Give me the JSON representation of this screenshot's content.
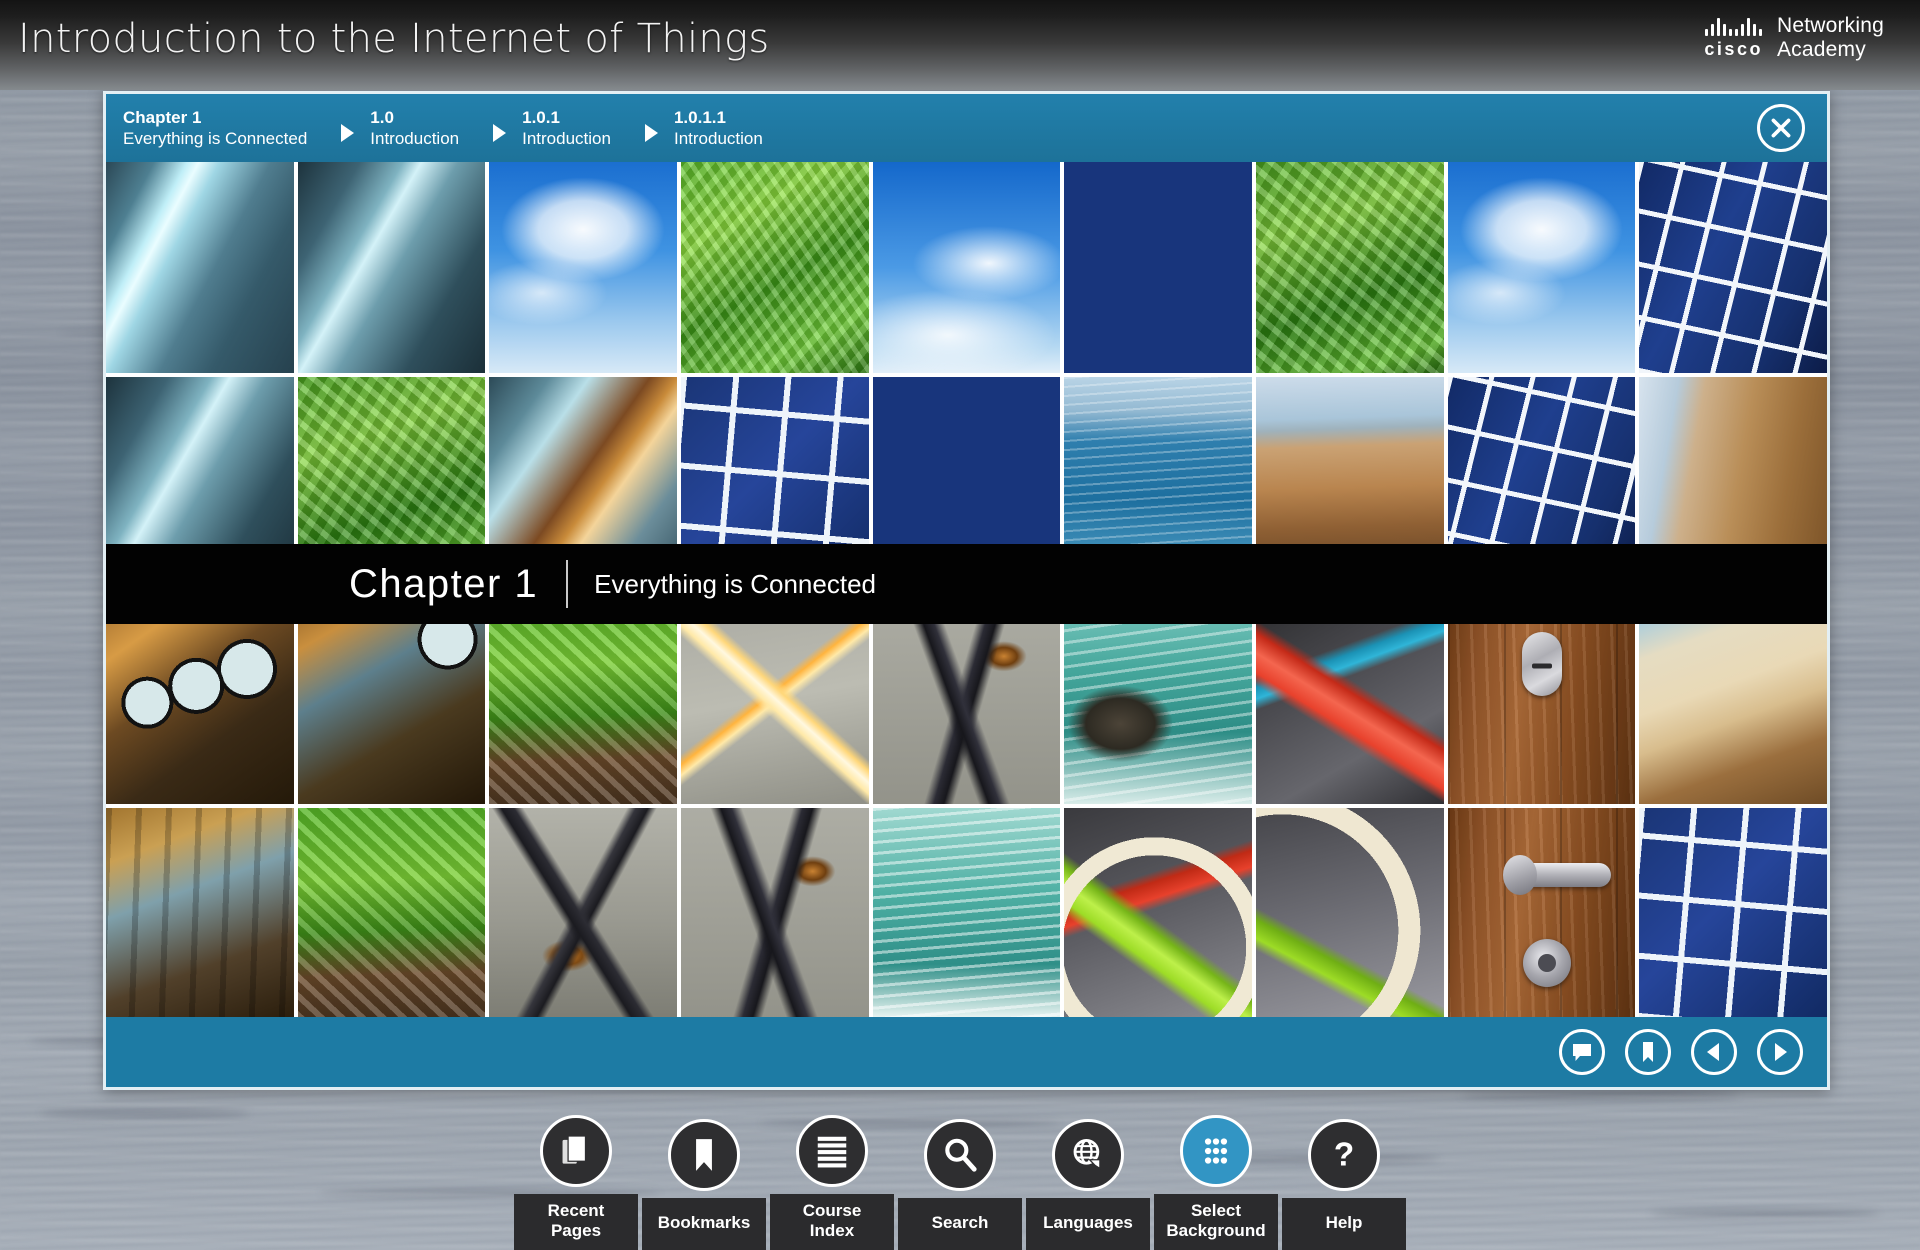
{
  "header": {
    "course_title": "Introduction to the Internet of Things",
    "brand": {
      "mark": "cisco",
      "line1": "Networking",
      "line2": "Academy"
    }
  },
  "viewer": {
    "breadcrumbs": [
      {
        "num": "Chapter 1",
        "sub": "Everything is Connected"
      },
      {
        "num": "1.0",
        "sub": "Introduction"
      },
      {
        "num": "1.0.1",
        "sub": "Introduction"
      },
      {
        "num": "1.0.1.1",
        "sub": "Introduction"
      }
    ],
    "close_icon": "close-icon",
    "chapter_band": {
      "number": "Chapter 1",
      "subtitle": "Everything is Connected"
    },
    "footer_buttons": [
      {
        "name": "notes-button",
        "icon": "speech-bubble-icon"
      },
      {
        "name": "bookmark-button",
        "icon": "bookmark-icon"
      },
      {
        "name": "previous-button",
        "icon": "triangle-left-icon"
      },
      {
        "name": "next-button",
        "icon": "triangle-right-icon"
      }
    ],
    "accent_color": "#1d7ba4",
    "breadcrumb_color": "#2280ac"
  },
  "mosaic": {
    "rows": [
      [
        "pipe-steel",
        "pipe-steel-dark",
        "sky-clouds",
        "green-leaves",
        "sky-clouds-2",
        "solar-panels",
        "green-grass",
        "sky-clouds-3",
        "solar-panels-2"
      ],
      [
        "pipe-steel-under",
        "green-leaves-2",
        "pipe-industrial",
        "solar-panels-3",
        "solar-panels-4",
        "ocean-rocks",
        "rock-pillars",
        "solar-panels-5",
        "cliff-rock"
      ],
      [
        "gauges",
        "gauges-2",
        "green-plant-soil",
        "wire-filament",
        "wire-filament-2",
        "ocean-surf",
        "bicycle-red",
        "door-wood-lock",
        "beach-cliff"
      ],
      [
        "pipes-industrial",
        "green-leaves-soil",
        "wire-burnt",
        "wire-burnt-2",
        "ocean-waves",
        "bicycle-wheel",
        "bicycle-wheel-2",
        "door-wood-handle",
        "solar-panel-close"
      ]
    ]
  },
  "toolbar": {
    "items": [
      {
        "label": "Recent\nPages",
        "icon": "book-pages-icon",
        "name": "recent-pages-button",
        "active": false
      },
      {
        "label": "Bookmarks",
        "icon": "bookmark-icon",
        "name": "bookmarks-button",
        "active": false
      },
      {
        "label": "Course\nIndex",
        "icon": "list-lines-icon",
        "name": "course-index-button",
        "active": false
      },
      {
        "label": "Search",
        "icon": "magnifier-icon",
        "name": "search-button",
        "active": false
      },
      {
        "label": "Languages",
        "icon": "globe-speech-icon",
        "name": "languages-button",
        "active": false
      },
      {
        "label": "Select\nBackground",
        "icon": "grid-dots-icon",
        "name": "select-background-button",
        "active": true
      },
      {
        "label": "Help",
        "icon": "question-icon",
        "name": "help-button",
        "active": false
      }
    ],
    "active_color": "#3295c4"
  }
}
